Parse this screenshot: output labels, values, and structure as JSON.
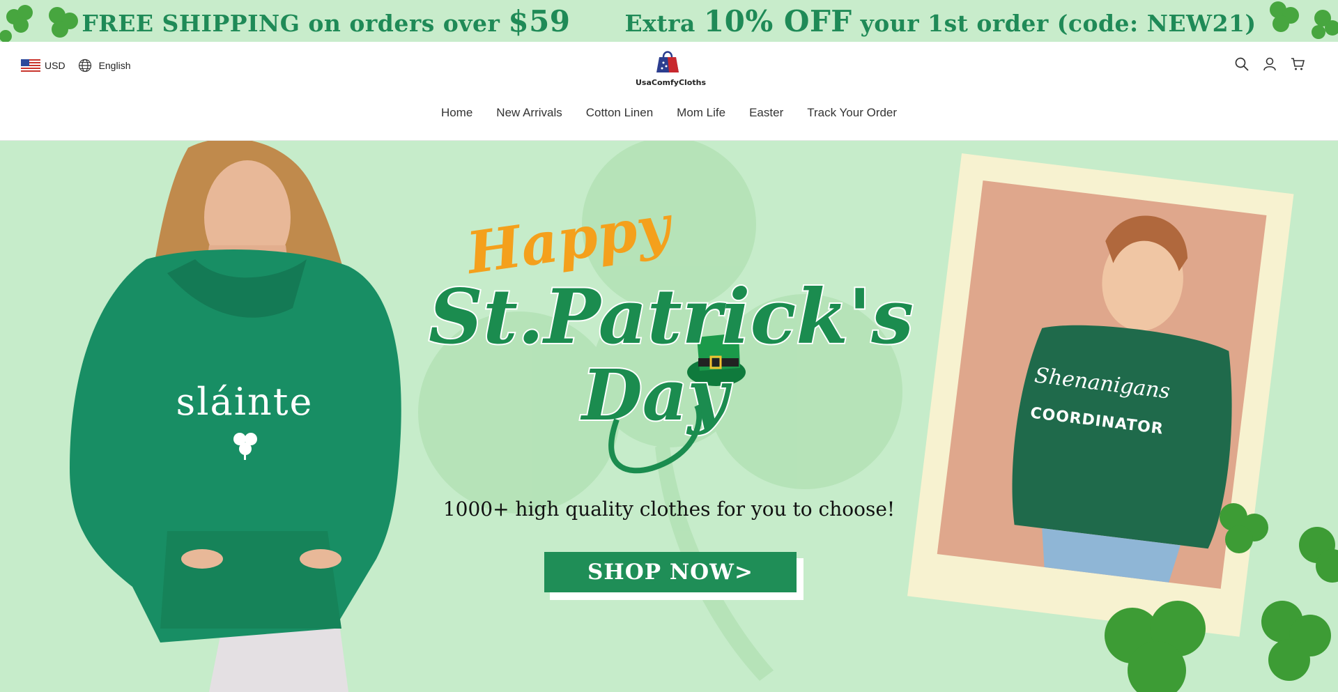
{
  "announcement": {
    "part1": "FREE SHIPPING on orders over",
    "amount": "$59",
    "part2": "Extra",
    "discount": "10% OFF",
    "part3": "your 1st order (code: NEW21)"
  },
  "header": {
    "currency": "USD",
    "language": "English",
    "logo_text": "UsaComfyCloths",
    "icons": [
      "search-icon",
      "account-icon",
      "cart-icon"
    ]
  },
  "nav": {
    "items": [
      {
        "label": "Home"
      },
      {
        "label": "New Arrivals"
      },
      {
        "label": "Cotton Linen"
      },
      {
        "label": "Mom Life"
      },
      {
        "label": "Easter"
      },
      {
        "label": "Track Your Order"
      }
    ]
  },
  "hero": {
    "headline_happy": "Happy",
    "headline_main": "St.Patrick's",
    "headline_day": "Day",
    "tagline": "1000+ high quality clothes for you to choose!",
    "cta_label": "SHOP NOW>",
    "hoodie_print": "sláinte",
    "sweatshirt_print_top": "Shenanigans",
    "sweatshirt_print_bottom": "COORDINATOR"
  },
  "colors": {
    "announcement_bg": "#c8eccb",
    "hero_bg": "#c6ecca",
    "brand_green": "#1f8e57",
    "accent_orange": "#f4a01c"
  }
}
